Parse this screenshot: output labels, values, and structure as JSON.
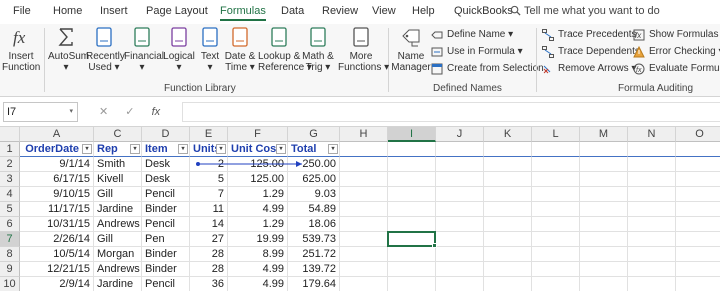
{
  "tabs": [
    "File",
    "Home",
    "Insert",
    "Page Layout",
    "Formulas",
    "Data",
    "Review",
    "View",
    "Help",
    "QuickBooks"
  ],
  "active_tab": "Formulas",
  "tell_me": "Tell me what you want to do",
  "accent": "#217346",
  "ribbon": {
    "insert_function": [
      "Insert",
      "Function"
    ],
    "library": [
      {
        "l1": "AutoSum",
        "l2": "▾",
        "icon": "sigma-icon"
      },
      {
        "l1": "Recently",
        "l2": "Used ▾",
        "icon": "star-book-icon"
      },
      {
        "l1": "Financial",
        "l2": "▾",
        "icon": "financial-book-icon"
      },
      {
        "l1": "Logical",
        "l2": "▾",
        "icon": "logical-book-icon"
      },
      {
        "l1": "Text",
        "l2": "▾",
        "icon": "text-book-icon"
      },
      {
        "l1": "Date &",
        "l2": "Time ▾",
        "icon": "date-time-book-icon"
      },
      {
        "l1": "Lookup &",
        "l2": "Reference ▾",
        "icon": "lookup-book-icon"
      },
      {
        "l1": "Math &",
        "l2": "Trig ▾",
        "icon": "math-book-icon"
      },
      {
        "l1": "More",
        "l2": "Functions ▾",
        "icon": "more-functions-book-icon"
      }
    ],
    "library_label": "Function Library",
    "name_manager": [
      "Name",
      "Manager"
    ],
    "define_name": "Define Name ▾",
    "use_in_formula": "Use in Formula ▾",
    "create_from_selection": "Create from Selection",
    "defined_names_label": "Defined Names",
    "trace_precedents": "Trace Precedents",
    "trace_dependents": "Trace Dependents",
    "remove_arrows": "Remove Arrows ▾",
    "show_formulas": "Show Formulas",
    "error_checking": "Error Checking ▾",
    "evaluate_formula": "Evaluate Formula",
    "auditing_label": "Formula Auditing"
  },
  "formula_bar": {
    "name_box": "I7",
    "formula": ""
  },
  "columns": [
    "A",
    "C",
    "D",
    "E",
    "F",
    "G",
    "H",
    "I",
    "J",
    "K",
    "L",
    "M",
    "N",
    "O"
  ],
  "selected_col": "I",
  "selected_row": "7",
  "header_row": [
    "OrderDate",
    "Rep",
    "Item",
    "Units",
    "Unit Cost",
    "Total"
  ],
  "rows": [
    {
      "n": "2",
      "cells": [
        "9/1/14",
        "Smith",
        "Desk",
        "2",
        "125.00",
        "250.00"
      ]
    },
    {
      "n": "3",
      "cells": [
        "6/17/15",
        "Kivell",
        "Desk",
        "5",
        "125.00",
        "625.00"
      ]
    },
    {
      "n": "4",
      "cells": [
        "9/10/15",
        "Gill",
        "Pencil",
        "7",
        "1.29",
        "9.03"
      ]
    },
    {
      "n": "5",
      "cells": [
        "11/17/15",
        "Jardine",
        "Binder",
        "11",
        "4.99",
        "54.89"
      ]
    },
    {
      "n": "6",
      "cells": [
        "10/31/15",
        "Andrews",
        "Pencil",
        "14",
        "1.29",
        "18.06"
      ]
    },
    {
      "n": "7",
      "cells": [
        "2/26/14",
        "Gill",
        "Pen",
        "27",
        "19.99",
        "539.73"
      ]
    },
    {
      "n": "8",
      "cells": [
        "10/5/14",
        "Morgan",
        "Binder",
        "28",
        "8.99",
        "251.72"
      ]
    },
    {
      "n": "9",
      "cells": [
        "12/21/15",
        "Andrews",
        "Binder",
        "28",
        "4.99",
        "139.72"
      ]
    },
    {
      "n": "10",
      "cells": [
        "2/9/14",
        "Jardine",
        "Pencil",
        "36",
        "4.99",
        "179.64"
      ]
    }
  ],
  "header_row_number": "1",
  "dropdown_glyph": "▾",
  "formula_icons": {
    "cancel": "✕",
    "enter": "✓",
    "fx": "fx"
  }
}
